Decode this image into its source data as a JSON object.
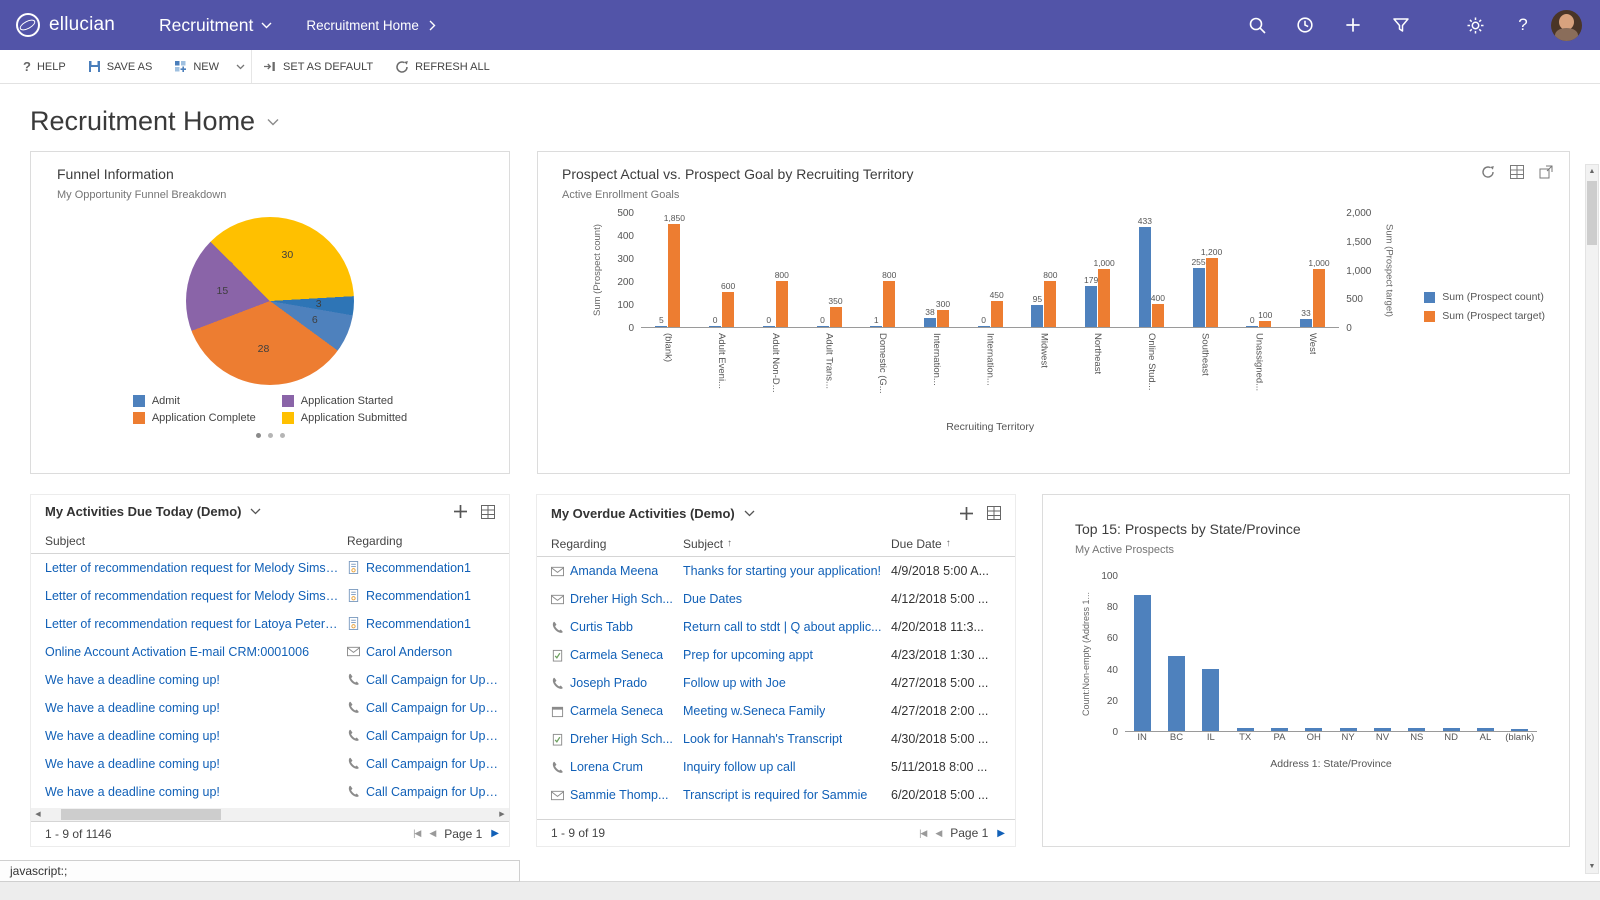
{
  "header": {
    "brand": "ellucian",
    "app_menu": "Recruitment",
    "current_page": "Recruitment Home"
  },
  "command_bar": {
    "help": "HELP",
    "save_as": "SAVE AS",
    "new": "NEW",
    "set_as_default": "SET AS DEFAULT",
    "refresh_all": "REFRESH ALL"
  },
  "page": {
    "title": "Recruitment Home"
  },
  "status_bar": {
    "text": "javascript:;"
  },
  "panels": {
    "funnel": {
      "title": "Funnel Information",
      "subtitle": "My Opportunity Funnel Breakdown"
    },
    "prospect": {
      "title": "Prospect Actual vs. Prospect Goal by Recruiting Territory",
      "subtitle": "Active Enrollment Goals"
    },
    "due_today": {
      "title": "My Activities Due Today (Demo)",
      "columns": [
        {
          "label": "Subject"
        },
        {
          "label": "Regarding"
        }
      ],
      "rows": [
        {
          "icon": "cert",
          "subject": "Letter of recommendation request for Melody Sims C...",
          "regarding": "Recommendation1"
        },
        {
          "icon": "cert",
          "subject": "Letter of recommendation request for Melody Sims C...",
          "regarding": "Recommendation1"
        },
        {
          "icon": "cert",
          "subject": "Letter of recommendation request for Latoya Peterse...",
          "regarding": "Recommendation1"
        },
        {
          "icon": "mail",
          "subject": "Online Account Activation E-mail CRM:0001006",
          "regarding": "Carol Anderson"
        },
        {
          "icon": "phone",
          "subject": "We have a deadline coming up!",
          "regarding": "Call Campaign for Upcomin"
        },
        {
          "icon": "phone",
          "subject": "We have a deadline coming up!",
          "regarding": "Call Campaign for Upcomin"
        },
        {
          "icon": "phone",
          "subject": "We have a deadline coming up!",
          "regarding": "Call Campaign for Upcomin"
        },
        {
          "icon": "phone",
          "subject": "We have a deadline coming up!",
          "regarding": "Call Campaign for Upcomin"
        },
        {
          "icon": "phone",
          "subject": "We have a deadline coming up!",
          "regarding": "Call Campaign for Upcomin"
        }
      ],
      "footer": {
        "range": "1 - 9 of 1146",
        "page": "Page 1"
      }
    },
    "overdue": {
      "title": "My Overdue Activities (Demo)",
      "columns": [
        {
          "label": "Regarding"
        },
        {
          "label": "Subject",
          "sort": "asc"
        },
        {
          "label": "Due Date",
          "sort": "asc"
        }
      ],
      "rows": [
        {
          "icon": "mail",
          "regarding": "Amanda Meena",
          "subject": "Thanks for starting your application!",
          "due": "4/9/2018 5:00 A..."
        },
        {
          "icon": "mail",
          "regarding": "Dreher High Sch...",
          "subject": "Due Dates",
          "due": "4/12/2018 5:00 ..."
        },
        {
          "icon": "phone",
          "regarding": "Curtis Tabb",
          "subject": "Return call to stdt | Q about applic...",
          "due": "4/20/2018 11:3..."
        },
        {
          "icon": "task",
          "regarding": "Carmela Seneca",
          "subject": "Prep for upcoming appt",
          "due": "4/23/2018 1:30 ..."
        },
        {
          "icon": "phone",
          "regarding": "Joseph Prado",
          "subject": "Follow up with Joe",
          "due": "4/27/2018 5:00 ..."
        },
        {
          "icon": "appt",
          "regarding": "Carmela Seneca",
          "subject": "Meeting w.Seneca Family",
          "due": "4/27/2018 2:00 ..."
        },
        {
          "icon": "task",
          "regarding": "Dreher High Sch...",
          "subject": "Look for Hannah's Transcript",
          "due": "4/30/2018 5:00 ..."
        },
        {
          "icon": "phone",
          "regarding": "Lorena Crum",
          "subject": "Inquiry follow up call",
          "due": "5/11/2018 8:00 ..."
        },
        {
          "icon": "mail",
          "regarding": "Sammie Thomp...",
          "subject": "Transcript is required for Sammie",
          "due": "6/20/2018 5:00 ..."
        }
      ],
      "footer": {
        "range": "1 - 9 of 19",
        "page": "Page 1"
      }
    },
    "top15": {
      "title": "Top 15: Prospects by State/Province",
      "subtitle": "My Active Prospects"
    }
  },
  "chart_data": [
    {
      "id": "funnel_pie",
      "type": "pie",
      "title": "My Opportunity Funnel Breakdown",
      "start_angle": -45,
      "segments": [
        {
          "label": "Application Submitted",
          "value": 30,
          "color": "#ffc000"
        },
        {
          "label": "",
          "value": 3,
          "color": "#2e75b6"
        },
        {
          "label": "Admit",
          "value": 6,
          "color": "#4e81bd"
        },
        {
          "label": "Application Complete",
          "value": 28,
          "color": "#ed7d31"
        },
        {
          "label": "Application Started",
          "value": 15,
          "color": "#8a64a8"
        }
      ],
      "legend": [
        {
          "label": "Admit",
          "color": "#4e81bd"
        },
        {
          "label": "Application Started",
          "color": "#8a64a8"
        },
        {
          "label": "Application Complete",
          "color": "#ed7d31"
        },
        {
          "label": "Application Submitted",
          "color": "#ffc000"
        }
      ]
    },
    {
      "id": "prospect_bars",
      "type": "bar",
      "title": "Prospect Actual vs. Prospect Goal by Recruiting Territory",
      "subtitle": "Active Enrollment Goals",
      "categories": [
        "(blank)",
        "Adult Eveni...",
        "Adult Non-D...",
        "Adult Trans...",
        "Domestic (G...",
        "Internation...",
        "Internation...",
        "Midwest",
        "Northeast",
        "Online Stud...",
        "Southeast",
        "Unassigned...",
        "West"
      ],
      "series": [
        {
          "name": "Sum (Prospect count)",
          "color": "#4e81bd",
          "axis": "left",
          "values": [
            5,
            0,
            0,
            0,
            1,
            38,
            0,
            95,
            179,
            433,
            255,
            0,
            33
          ]
        },
        {
          "name": "Sum (Prospect target)",
          "color": "#ed7d31",
          "axis": "right",
          "values": [
            1850,
            600,
            800,
            350,
            800,
            300,
            450,
            800,
            1000,
            400,
            1200,
            100,
            1000
          ]
        }
      ],
      "left_axis": {
        "label": "Sum (Prospect count)",
        "ticks": [
          0,
          100,
          200,
          300,
          400,
          500
        ],
        "max": 500
      },
      "right_axis": {
        "label": "Sum (Prospect target)",
        "ticks": [
          0,
          500,
          1000,
          1500,
          2000
        ],
        "max": 2000
      },
      "xlabel": "Recruiting Territory",
      "legend_position": "right",
      "grid": false
    },
    {
      "id": "top15_bars",
      "type": "bar",
      "title": "Top 15: Prospects by State/Province",
      "subtitle": "My Active Prospects",
      "categories": [
        "IN",
        "BC",
        "IL",
        "TX",
        "PA",
        "OH",
        "NY",
        "NV",
        "NS",
        "ND",
        "AL",
        "(blank)"
      ],
      "series": [
        {
          "name": "Count:Non-empty (Address 1...",
          "color": "#4e81bd",
          "axis": "left",
          "values": [
            87,
            48,
            40,
            2,
            2,
            2,
            2,
            2,
            2,
            2,
            2,
            1
          ]
        }
      ],
      "left_axis": {
        "label": "Count:Non-empty (Address 1...",
        "ticks": [
          0,
          20,
          40,
          60,
          80,
          100
        ],
        "max": 100
      },
      "xlabel": "Address 1: State/Province",
      "grid": false
    }
  ]
}
